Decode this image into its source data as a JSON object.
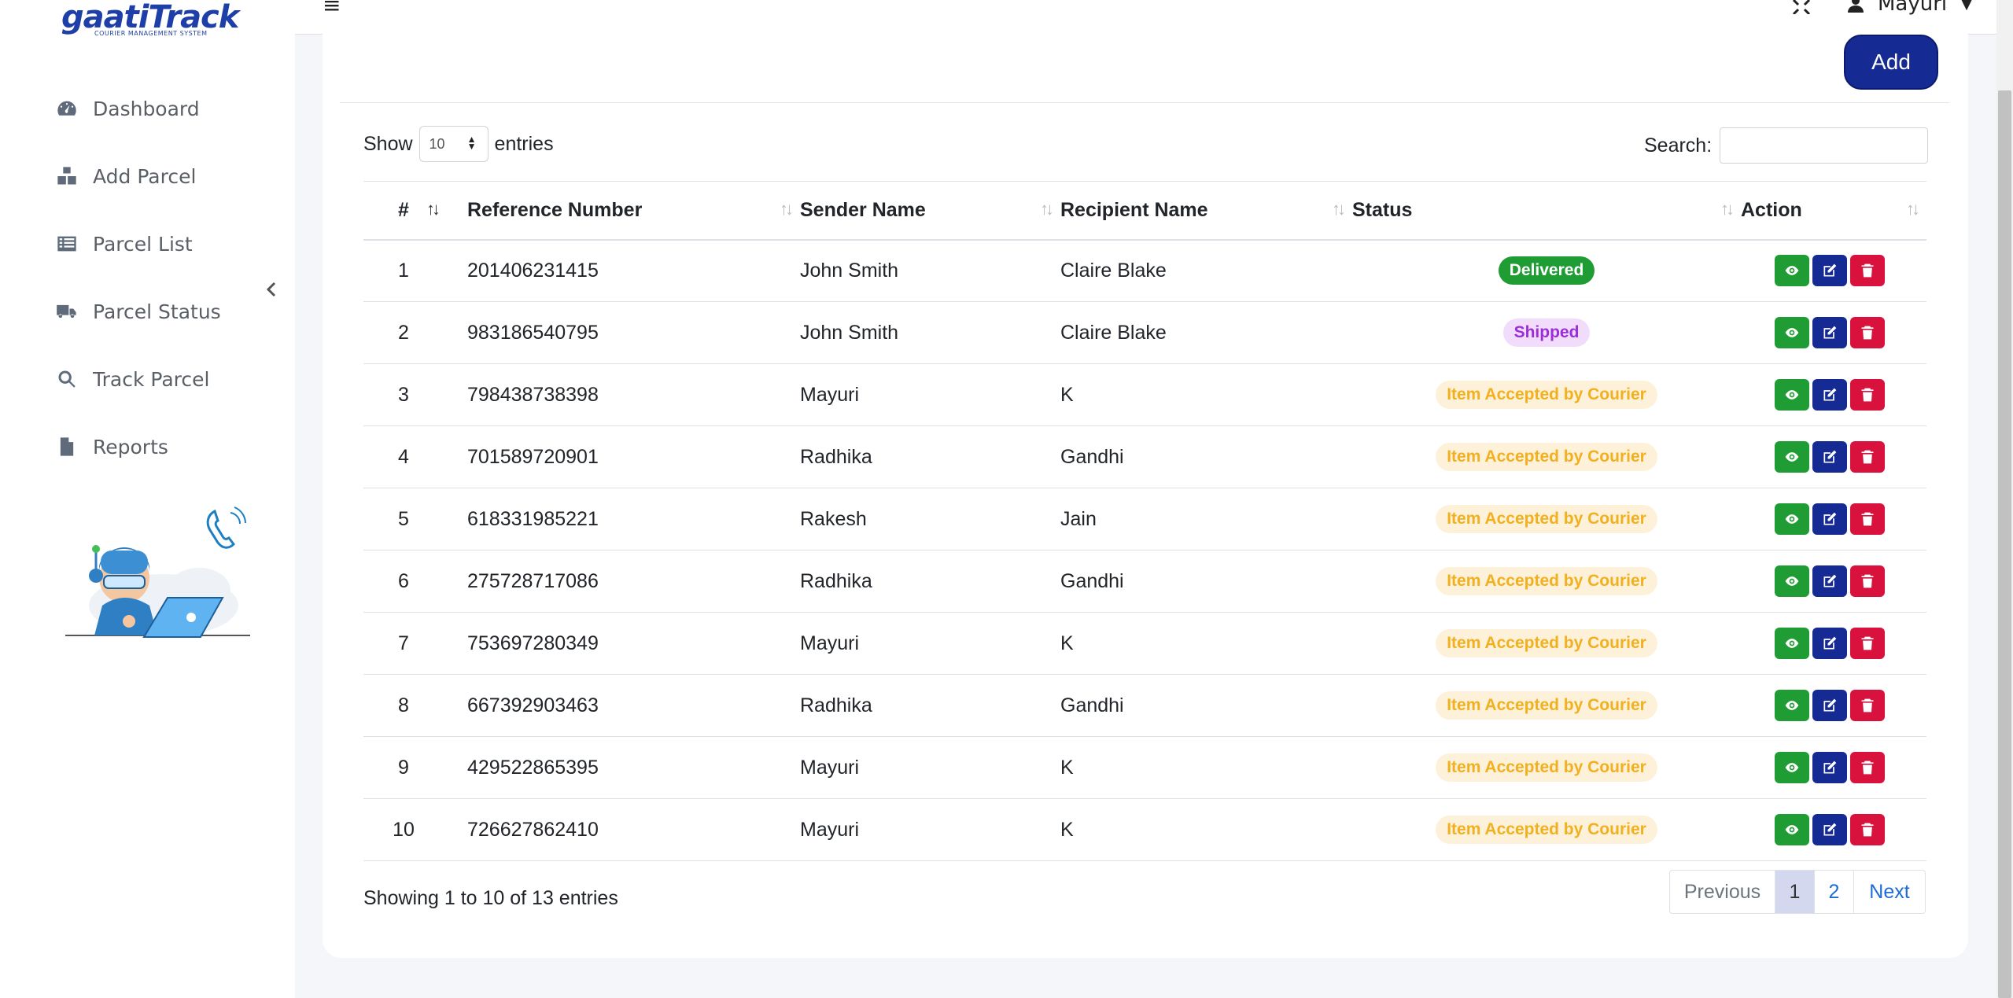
{
  "brand": {
    "name": "gaatiTrack",
    "tagline": "COURIER MANAGEMENT SYSTEM"
  },
  "sidebar": {
    "items": [
      {
        "label": "Dashboard",
        "icon": "dashboard-gauge-icon"
      },
      {
        "label": "Add Parcel",
        "icon": "boxes-icon"
      },
      {
        "label": "Parcel List",
        "icon": "list-icon"
      },
      {
        "label": "Parcel Status",
        "icon": "truck-icon"
      },
      {
        "label": "Track Parcel",
        "icon": "search-icon"
      },
      {
        "label": "Reports",
        "icon": "file-icon"
      }
    ]
  },
  "topbar": {
    "user_name": "Mayuri"
  },
  "toolbar": {
    "add_label": "Add"
  },
  "table_controls": {
    "show_label": "Show",
    "entries_value": "10",
    "entries_label": "entries",
    "search_label": "Search:",
    "search_value": ""
  },
  "table": {
    "headers": [
      "#",
      "Reference Number",
      "Sender Name",
      "Recipient Name",
      "Status",
      "Action"
    ],
    "rows": [
      {
        "num": "1",
        "ref": "201406231415",
        "sender": "John Smith",
        "recipient": "Claire Blake",
        "status": "Delivered"
      },
      {
        "num": "2",
        "ref": "983186540795",
        "sender": "John Smith",
        "recipient": "Claire Blake",
        "status": "Shipped"
      },
      {
        "num": "3",
        "ref": "798438738398",
        "sender": "Mayuri",
        "recipient": "K",
        "status": "Item Accepted by Courier"
      },
      {
        "num": "4",
        "ref": "701589720901",
        "sender": "Radhika",
        "recipient": "Gandhi",
        "status": "Item Accepted by Courier"
      },
      {
        "num": "5",
        "ref": "618331985221",
        "sender": "Rakesh",
        "recipient": "Jain",
        "status": "Item Accepted by Courier"
      },
      {
        "num": "6",
        "ref": "275728717086",
        "sender": "Radhika",
        "recipient": "Gandhi",
        "status": "Item Accepted by Courier"
      },
      {
        "num": "7",
        "ref": "753697280349",
        "sender": "Mayuri",
        "recipient": "K",
        "status": "Item Accepted by Courier"
      },
      {
        "num": "8",
        "ref": "667392903463",
        "sender": "Radhika",
        "recipient": "Gandhi",
        "status": "Item Accepted by Courier"
      },
      {
        "num": "9",
        "ref": "429522865395",
        "sender": "Mayuri",
        "recipient": "K",
        "status": "Item Accepted by Courier"
      },
      {
        "num": "10",
        "ref": "726627862410",
        "sender": "Mayuri",
        "recipient": "K",
        "status": "Item Accepted by Courier"
      }
    ]
  },
  "footer": {
    "info": "Showing 1 to 10 of 13 entries",
    "pagination": {
      "prev": "Previous",
      "pages": [
        "1",
        "2"
      ],
      "next": "Next"
    }
  },
  "colors": {
    "primary": "#162a93",
    "success": "#1f9d34",
    "danger": "#d8123c",
    "shipped_bg": "#f1ddfb",
    "shipped_text": "#9b2ed9",
    "accepted_bg": "#fdf1d9",
    "accepted_text": "#f2b01e"
  }
}
